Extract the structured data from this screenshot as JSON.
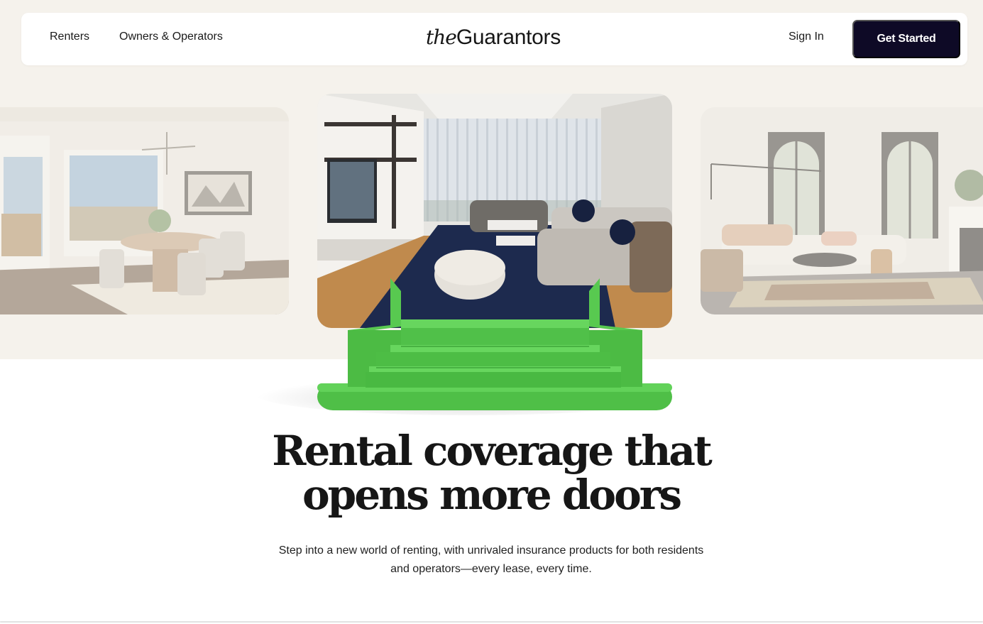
{
  "nav": {
    "renters": "Renters",
    "owners": "Owners & Operators",
    "logo_the": "the",
    "logo_brand": "Guarantors",
    "sign_in": "Sign In",
    "get_started": "Get Started"
  },
  "hero": {
    "headline": "Rental coverage that opens more doors",
    "subtext": "Step into a new world of renting, with unrivaled insurance products for both residents and operators—every lease, every time."
  },
  "colors": {
    "hero_background": "#f5f2ec",
    "primary_button": "#0e0a26",
    "steps_green": "#56c84e"
  },
  "icons": {
    "photo_left": "dining-room-photo",
    "photo_center": "living-room-photo",
    "photo_right": "lounge-photo",
    "steps": "green-steps-illustration"
  }
}
